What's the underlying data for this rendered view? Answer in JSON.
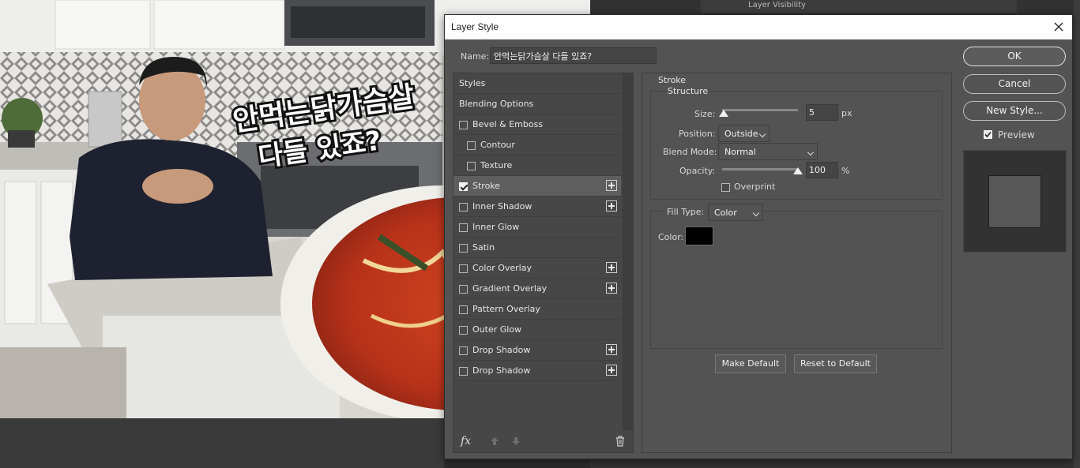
{
  "background": {
    "panel_item": "Layer Visibility",
    "overlay_text": [
      "안먹는닭가슴살",
      "다들 있죠?"
    ]
  },
  "dialog": {
    "title": "Layer Style",
    "name_label": "Name:",
    "name_value": "안먹는닭가슴살 다들 있죠?",
    "styles": [
      {
        "label": "Styles",
        "checkbox": false,
        "indent": false,
        "plus": false,
        "checked": false,
        "selected": false
      },
      {
        "label": "Blending Options",
        "checkbox": false,
        "indent": false,
        "plus": false,
        "checked": false,
        "selected": false
      },
      {
        "label": "Bevel & Emboss",
        "checkbox": true,
        "indent": false,
        "plus": false,
        "checked": false,
        "selected": false
      },
      {
        "label": "Contour",
        "checkbox": true,
        "indent": true,
        "plus": false,
        "checked": false,
        "selected": false
      },
      {
        "label": "Texture",
        "checkbox": true,
        "indent": true,
        "plus": false,
        "checked": false,
        "selected": false
      },
      {
        "label": "Stroke",
        "checkbox": true,
        "indent": false,
        "plus": true,
        "checked": true,
        "selected": true
      },
      {
        "label": "Inner Shadow",
        "checkbox": true,
        "indent": false,
        "plus": true,
        "checked": false,
        "selected": false
      },
      {
        "label": "Inner Glow",
        "checkbox": true,
        "indent": false,
        "plus": false,
        "checked": false,
        "selected": false
      },
      {
        "label": "Satin",
        "checkbox": true,
        "indent": false,
        "plus": false,
        "checked": false,
        "selected": false
      },
      {
        "label": "Color Overlay",
        "checkbox": true,
        "indent": false,
        "plus": true,
        "checked": false,
        "selected": false
      },
      {
        "label": "Gradient Overlay",
        "checkbox": true,
        "indent": false,
        "plus": true,
        "checked": false,
        "selected": false
      },
      {
        "label": "Pattern Overlay",
        "checkbox": true,
        "indent": false,
        "plus": false,
        "checked": false,
        "selected": false
      },
      {
        "label": "Outer Glow",
        "checkbox": true,
        "indent": false,
        "plus": false,
        "checked": false,
        "selected": false
      },
      {
        "label": "Drop Shadow",
        "checkbox": true,
        "indent": false,
        "plus": true,
        "checked": false,
        "selected": false
      },
      {
        "label": "Drop Shadow",
        "checkbox": true,
        "indent": false,
        "plus": true,
        "checked": false,
        "selected": false
      }
    ],
    "footer_icons": [
      "fx-icon",
      "move-up-icon",
      "move-down-icon",
      "trash-icon"
    ],
    "stroke": {
      "section_title": "Stroke",
      "structure_title": "Structure",
      "size_label": "Size:",
      "size_value": "5",
      "size_unit": "px",
      "size_fraction": 0.02,
      "position_label": "Position:",
      "position_value": "Outside",
      "blend_label": "Blend Mode:",
      "blend_value": "Normal",
      "opacity_label": "Opacity:",
      "opacity_value": "100",
      "opacity_unit": "%",
      "opacity_fraction": 1.0,
      "overprint_label": "Overprint",
      "fill_type_label": "Fill Type:",
      "fill_type_value": "Color",
      "color_label": "Color:",
      "color_value": "#000000",
      "make_default": "Make Default",
      "reset_default": "Reset to Default"
    },
    "buttons": {
      "ok": "OK",
      "cancel": "Cancel",
      "new_style": "New Style...",
      "preview_label": "Preview"
    }
  }
}
